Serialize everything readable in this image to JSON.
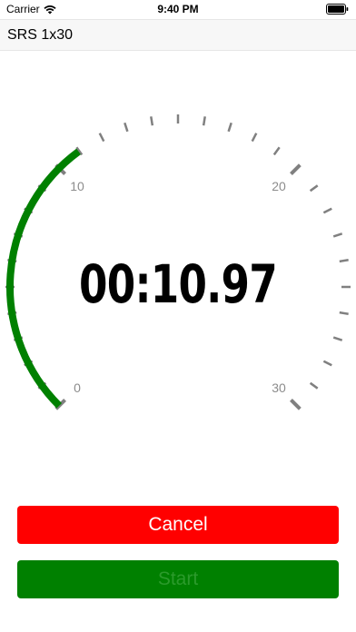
{
  "status_bar": {
    "carrier": "Carrier",
    "time": "9:40 PM"
  },
  "title_field": {
    "value": "SRS 1x30"
  },
  "timer": {
    "display": "00:10.97",
    "scale_labels": [
      "0",
      "10",
      "20",
      "30"
    ],
    "scale_max_seconds": 30,
    "elapsed_seconds": 10.97,
    "progress_color": "#008000",
    "tick_color": "#808080"
  },
  "buttons": {
    "cancel_label": "Cancel",
    "start_label": "Start",
    "cancel_color": "#ff0000",
    "start_color": "#008000"
  },
  "icons": {
    "wifi": "wifi-icon",
    "battery": "battery-icon"
  }
}
